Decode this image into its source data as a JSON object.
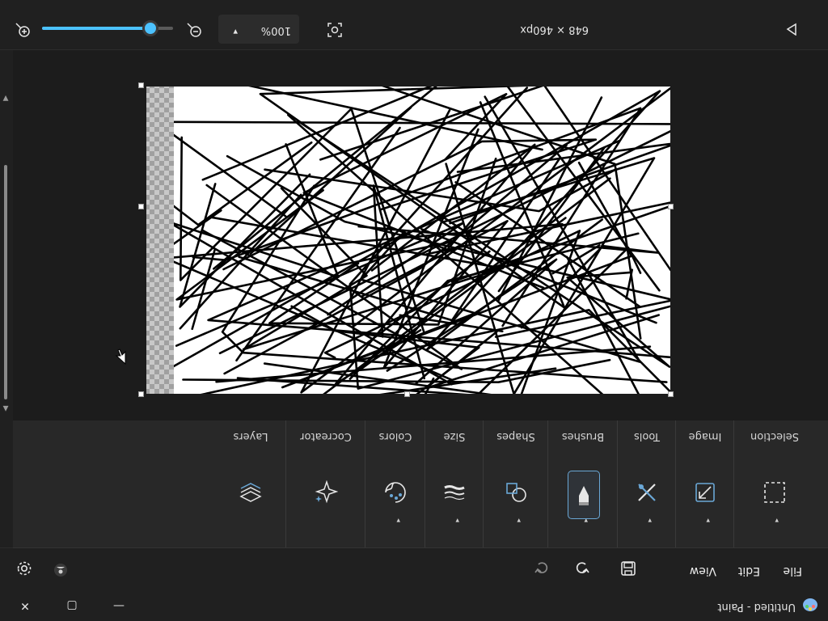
{
  "window": {
    "title": "Untitled - Paint",
    "minimize_glyph": "—",
    "maximize_glyph": "▢",
    "close_glyph": "✕"
  },
  "menu": {
    "file": "File",
    "edit": "Edit",
    "view": "View",
    "save_icon": "save-icon",
    "undo_icon": "undo-icon",
    "redo_icon": "redo-icon",
    "settings_icon": "gear-icon",
    "account_icon": "account-icon"
  },
  "ribbon": {
    "groups": [
      {
        "label": "Selection",
        "icon": "selection-icon",
        "caret": "▾",
        "active": false
      },
      {
        "label": "Image",
        "icon": "image-icon",
        "caret": "▾",
        "active": false
      },
      {
        "label": "Tools",
        "icon": "tools-icon",
        "caret": "▾",
        "active": false
      },
      {
        "label": "Brushes",
        "icon": "brush-icon",
        "caret": "▾",
        "active": true
      },
      {
        "label": "Shapes",
        "icon": "shapes-icon",
        "caret": "▾",
        "active": false
      },
      {
        "label": "Size",
        "icon": "size-icon",
        "caret": "▾",
        "active": false
      },
      {
        "label": "Colors",
        "icon": "palette-icon",
        "caret": "▾",
        "active": false
      },
      {
        "label": "Cocreator",
        "icon": "sparkle-icon",
        "caret": "",
        "active": false
      },
      {
        "label": "Layers",
        "icon": "layers-icon",
        "caret": "",
        "active": false
      }
    ]
  },
  "status": {
    "canvas_size": "648 × 460px",
    "zoom_value": "100%",
    "zoom_slider_level": 0.83
  },
  "colors": {
    "accent": "#4cc2ff",
    "background": "#202020",
    "ribbon": "#282828"
  }
}
